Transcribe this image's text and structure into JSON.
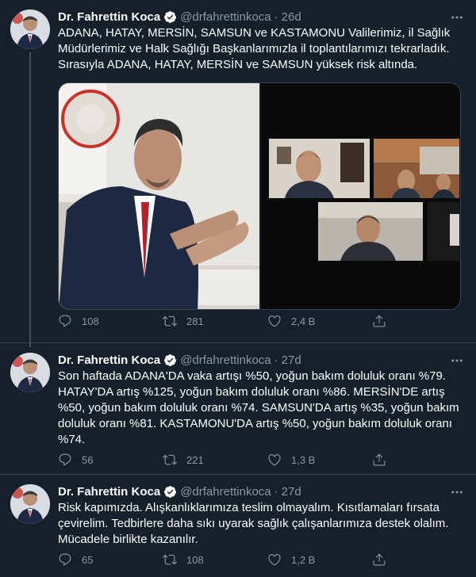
{
  "tweets": [
    {
      "author_name": "Dr. Fahrettin Koca",
      "handle": "@drfahrettinkoca",
      "separator": "·",
      "time": "26d",
      "text": "ADANA, HATAY, MERSİN, SAMSUN ve KASTAMONU Valilerimiz, il Sağlık Müdürlerimiz ve Halk Sağlığı Başkanlarımızla il toplantılarımızı tekrarladık. Sırasıyla ADANA, HATAY, MERSİN ve SAMSUN yüksek risk altında.",
      "replies": "108",
      "retweets": "281",
      "likes": "2,4 B"
    },
    {
      "author_name": "Dr. Fahrettin Koca",
      "handle": "@drfahrettinkoca",
      "separator": "·",
      "time": "27d",
      "text": "Son haftada ADANA'DA vaka artışı %50, yoğun bakım doluluk oranı %79. HATAY'DA artış %125, yoğun bakım doluluk oranı %86. MERSİN'DE artış %50, yoğun bakım doluluk oranı %74. SAMSUN'DA artış %35, yoğun bakım doluluk oranı %81. KASTAMONU'DA artış %50, yoğun bakım doluluk oranı %74.",
      "replies": "56",
      "retweets": "221",
      "likes": "1,3 B"
    },
    {
      "author_name": "Dr. Fahrettin Koca",
      "handle": "@drfahrettinkoca",
      "separator": "·",
      "time": "27d",
      "text": "Risk kapımızda. Alışkanlıklarımıza teslim olmayalım. Kısıtlamaları fırsata çevirelim. Tedbirlere daha sıkı uyarak sağlık çalışanlarımıza destek olalım. Mücadele birlikte kazanılır.",
      "replies": "65",
      "retweets": "108",
      "likes": "1,2 B"
    }
  ],
  "colors": {
    "background": "#15202b",
    "text": "#ffffff",
    "secondary": "#8899a6",
    "verified": "#ffffff",
    "divider": "#38444d"
  }
}
